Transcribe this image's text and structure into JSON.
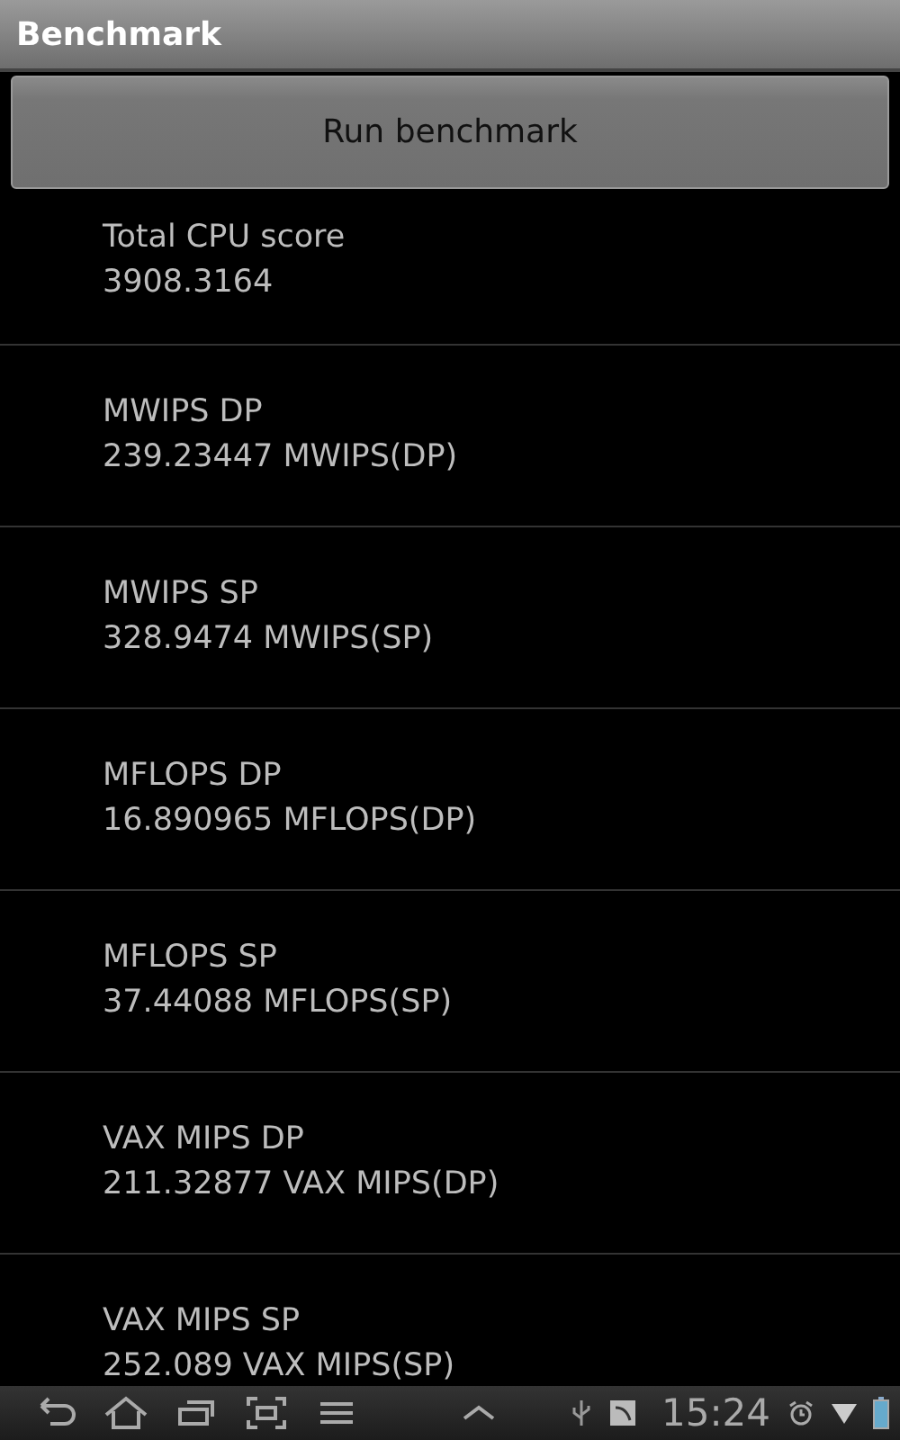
{
  "window": {
    "title": "Benchmark"
  },
  "run_button": {
    "label": "Run benchmark"
  },
  "results": [
    {
      "name": "Total CPU score",
      "value": "3908.3164"
    },
    {
      "name": "MWIPS DP",
      "value": "239.23447 MWIPS(DP)"
    },
    {
      "name": "MWIPS SP",
      "value": "328.9474 MWIPS(SP)"
    },
    {
      "name": "MFLOPS DP",
      "value": "16.890965 MFLOPS(DP)"
    },
    {
      "name": "MFLOPS SP",
      "value": "37.44088 MFLOPS(SP)"
    },
    {
      "name": "VAX MIPS DP",
      "value": "211.32877 VAX MIPS(DP)"
    },
    {
      "name": "VAX MIPS SP",
      "value": "252.089 VAX MIPS(SP)"
    }
  ],
  "status_bar": {
    "time": "15:24"
  }
}
